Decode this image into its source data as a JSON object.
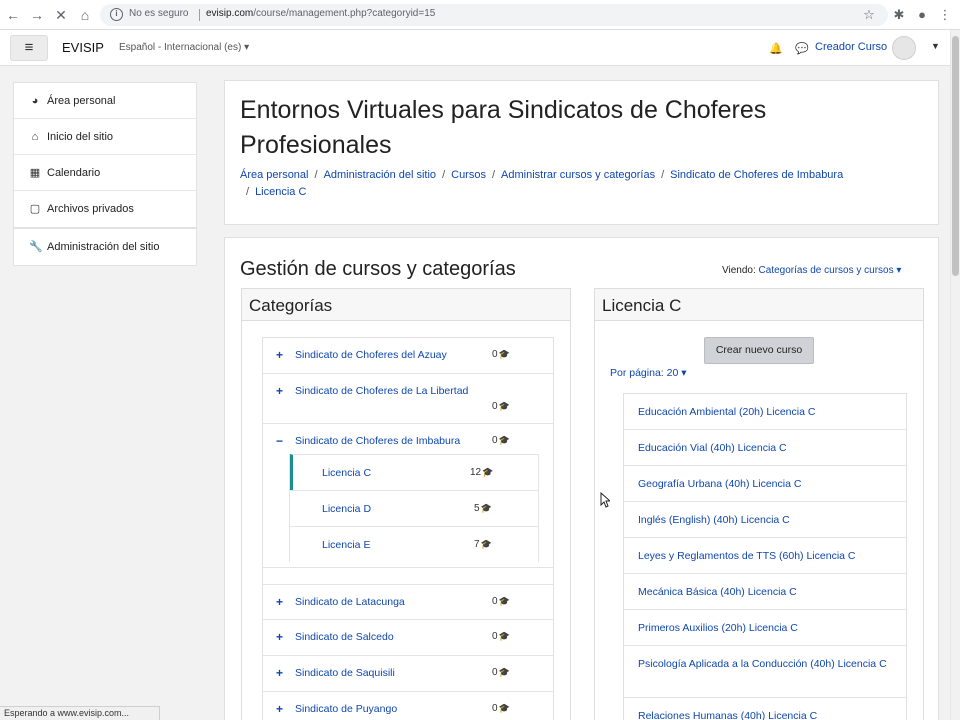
{
  "browser": {
    "not_secure_label": "No es seguro",
    "url_host": "evisip.com",
    "url_path": "/course/management.php?categoryid=15"
  },
  "navbar": {
    "brand": "EVISIP",
    "language": "Español - Internacional (es)",
    "user_name": "Creador Curso"
  },
  "drawer": {
    "items": [
      {
        "label": "Área personal",
        "icon": "dashboard-icon"
      },
      {
        "label": "Inicio del sitio",
        "icon": "home-icon"
      },
      {
        "label": "Calendario",
        "icon": "calendar-icon"
      },
      {
        "label": "Archivos privados",
        "icon": "file-icon"
      },
      {
        "label": "Administración del sitio",
        "icon": "wrench-icon"
      }
    ]
  },
  "header": {
    "title": "Entornos Virtuales para Sindicatos de Choferes Profesionales",
    "breadcrumbs": [
      "Área personal",
      "Administración del sitio",
      "Cursos",
      "Administrar cursos y categorías",
      "Sindicato de Choferes de Imbabura",
      "Licencia C"
    ]
  },
  "management": {
    "title": "Gestión de cursos y categorías",
    "viewing_label": "Viendo:",
    "viewing_value": "Categorías de cursos y cursos",
    "categories_panel_title": "Categorías",
    "categories": [
      {
        "name": "Sindicato de Choferes del Azuay",
        "count": "0",
        "toggle": "+"
      },
      {
        "name": "Sindicato de Choferes de La Libertad",
        "count": "0",
        "toggle": "+"
      },
      {
        "name": "Sindicato de Choferes de Imbabura",
        "count": "0",
        "toggle": "−",
        "children": [
          {
            "name": "Licencia C",
            "count": "12"
          },
          {
            "name": "Licencia D",
            "count": "5"
          },
          {
            "name": "Licencia E",
            "count": "7"
          }
        ]
      },
      {
        "name": "Sindicato de Latacunga",
        "count": "0",
        "toggle": "+"
      },
      {
        "name": "Sindicato de Salcedo",
        "count": "0",
        "toggle": "+"
      },
      {
        "name": "Sindicato de Saquisili",
        "count": "0",
        "toggle": "+"
      },
      {
        "name": "Sindicato de Puyango",
        "count": "0",
        "toggle": "+"
      }
    ],
    "courses_panel_title": "Licencia C",
    "new_course_button": "Crear nuevo curso",
    "per_page": "Por página: 20",
    "courses": [
      "Educación Ambiental (20h) Licencia C",
      "Educación Vial (40h) Licencia C",
      "Geografía Urbana (40h) Licencia C",
      "Inglés (English) (40h) Licencia C",
      "Leyes y Reglamentos de TTS (60h) Licencia C",
      "Mecánica Básica (40h) Licencia C",
      "Primeros Auxilios (20h) Licencia C",
      "Psicología Aplicada a la Conducción (40h) Licencia C",
      "Relaciones Humanas (40h) Licencia C"
    ]
  },
  "status_bar": "Esperando a www.evisip.com..."
}
